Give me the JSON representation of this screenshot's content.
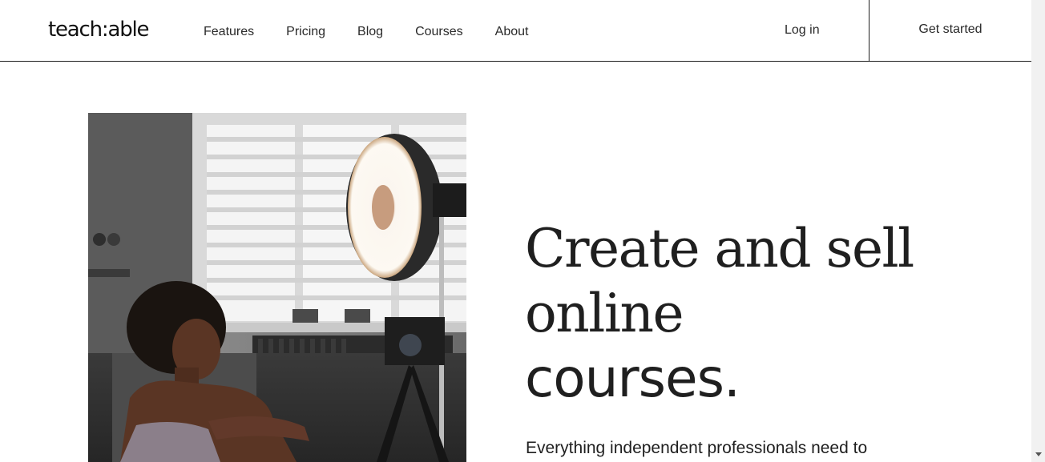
{
  "brand": {
    "logo_text": "teach:able"
  },
  "nav": {
    "items": [
      {
        "label": "Features"
      },
      {
        "label": "Pricing"
      },
      {
        "label": "Blog"
      },
      {
        "label": "Courses"
      },
      {
        "label": "About"
      }
    ],
    "login_label": "Log in",
    "cta_label": "Get started"
  },
  "hero": {
    "headline_line1": "Create and sell",
    "headline_line2": "online",
    "headline_line3": "courses.",
    "subtext": "Everything independent professionals need to",
    "image_alt": "woman sitting in front of camera and ring light"
  },
  "colors": {
    "text": "#1f1f1f",
    "border": "#1f1f1f",
    "background": "#ffffff"
  }
}
